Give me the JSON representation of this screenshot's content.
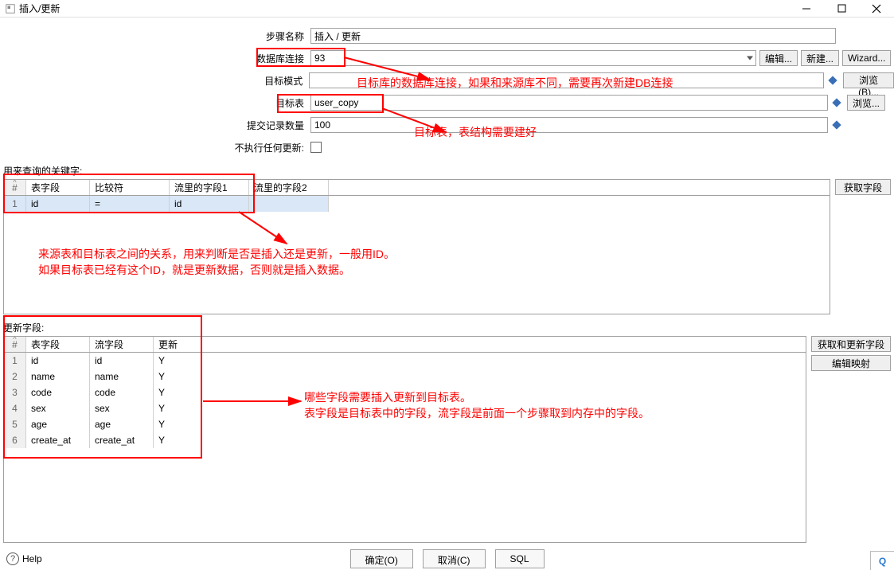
{
  "window": {
    "title": "插入/更新"
  },
  "form": {
    "step_name_label": "步骤名称",
    "step_name_value": "插入 / 更新",
    "db_conn_label": "数据库连接",
    "db_conn_value": "93",
    "schema_label": "目标模式",
    "schema_value": "",
    "table_label": "目标表",
    "table_value": "user_copy",
    "commit_label": "提交记录数量",
    "commit_value": "100",
    "noop_label": "不执行任何更新:"
  },
  "buttons": {
    "edit": "编辑...",
    "new": "新建...",
    "wizard": "Wizard...",
    "browse_b": "浏览(B)...",
    "browse": "浏览...",
    "get_fields": "获取字段",
    "get_update_fields": "获取和更新字段",
    "edit_mapping": "编辑映射",
    "ok": "确定(O)",
    "cancel": "取消(C)",
    "sql": "SQL",
    "help": "Help"
  },
  "sections": {
    "key_label": "用来查询的关键字:",
    "update_label": "更新字段:"
  },
  "key_table": {
    "headers": {
      "num": "#",
      "col1": "表字段",
      "col2": "比较符",
      "col3": "流里的字段1",
      "col4": "流里的字段2"
    },
    "rows": [
      {
        "num": "1",
        "col1": "id",
        "col2": "=",
        "col3": "id",
        "col4": ""
      }
    ]
  },
  "update_table": {
    "headers": {
      "num": "#",
      "col1": "表字段",
      "col2": "流字段",
      "col3": "更新"
    },
    "rows": [
      {
        "num": "1",
        "col1": "id",
        "col2": "id",
        "col3": "Y"
      },
      {
        "num": "2",
        "col1": "name",
        "col2": "name",
        "col3": "Y"
      },
      {
        "num": "3",
        "col1": "code",
        "col2": "code",
        "col3": "Y"
      },
      {
        "num": "4",
        "col1": "sex",
        "col2": "sex",
        "col3": "Y"
      },
      {
        "num": "5",
        "col1": "age",
        "col2": "age",
        "col3": "Y"
      },
      {
        "num": "6",
        "col1": "create_at",
        "col2": "create_at",
        "col3": "Y"
      }
    ]
  },
  "annotations": {
    "a1": "目标库的数据库连接，如果和来源库不同，需要再次新建DB连接",
    "a2": "目标表，表结构需要建好",
    "a3_line1": "来源表和目标表之间的关系，用来判断是否是插入还是更新，一般用ID。",
    "a3_line2": "如果目标表已经有这个ID，就是更新数据，否则就是插入数据。",
    "a4_line1": "哪些字段需要插入更新到目标表。",
    "a4_line2": "表字段是目标表中的字段，流字段是前面一个步骤取到内存中的字段。"
  },
  "corner_badge": "Q"
}
